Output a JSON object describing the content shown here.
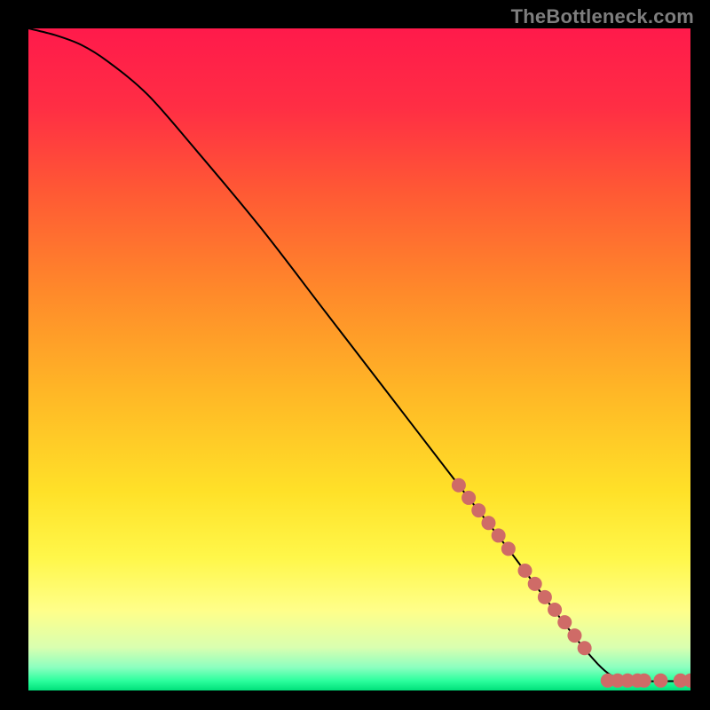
{
  "attribution": "TheBottleneck.com",
  "chart_data": {
    "type": "line",
    "title": "",
    "xlabel": "",
    "ylabel": "",
    "xlim": [
      0,
      100
    ],
    "ylim": [
      0,
      100
    ],
    "background_gradient": {
      "stops": [
        {
          "offset": 0.0,
          "color": "#ff1a4b"
        },
        {
          "offset": 0.12,
          "color": "#ff2e44"
        },
        {
          "offset": 0.25,
          "color": "#ff5a34"
        },
        {
          "offset": 0.4,
          "color": "#ff8a2a"
        },
        {
          "offset": 0.55,
          "color": "#ffb726"
        },
        {
          "offset": 0.7,
          "color": "#ffe128"
        },
        {
          "offset": 0.8,
          "color": "#fff74a"
        },
        {
          "offset": 0.88,
          "color": "#ffff8a"
        },
        {
          "offset": 0.935,
          "color": "#d9ffb0"
        },
        {
          "offset": 0.965,
          "color": "#8cffc0"
        },
        {
          "offset": 0.985,
          "color": "#2dff9e"
        },
        {
          "offset": 1.0,
          "color": "#00e07a"
        }
      ]
    },
    "series": [
      {
        "name": "curve",
        "color": "#000000",
        "points": [
          {
            "x": 0,
            "y": 100
          },
          {
            "x": 4,
            "y": 99
          },
          {
            "x": 8,
            "y": 97.5
          },
          {
            "x": 12,
            "y": 95
          },
          {
            "x": 18,
            "y": 90
          },
          {
            "x": 25,
            "y": 82
          },
          {
            "x": 35,
            "y": 70
          },
          {
            "x": 45,
            "y": 57
          },
          {
            "x": 55,
            "y": 44
          },
          {
            "x": 65,
            "y": 31
          },
          {
            "x": 72,
            "y": 22
          },
          {
            "x": 78,
            "y": 14
          },
          {
            "x": 83,
            "y": 7.5
          },
          {
            "x": 86,
            "y": 4
          },
          {
            "x": 88,
            "y": 2.3
          },
          {
            "x": 90,
            "y": 1.6
          },
          {
            "x": 93,
            "y": 1.4
          },
          {
            "x": 97,
            "y": 1.4
          },
          {
            "x": 100,
            "y": 1.4
          }
        ]
      }
    ],
    "highlight_points": {
      "name": "highlights",
      "color": "#cf6b67",
      "radius_px": 8,
      "points": [
        {
          "x": 65.0,
          "y": 31.0
        },
        {
          "x": 66.5,
          "y": 29.1
        },
        {
          "x": 68.0,
          "y": 27.2
        },
        {
          "x": 69.5,
          "y": 25.3
        },
        {
          "x": 71.0,
          "y": 23.4
        },
        {
          "x": 72.5,
          "y": 21.4
        },
        {
          "x": 75.0,
          "y": 18.1
        },
        {
          "x": 76.5,
          "y": 16.1
        },
        {
          "x": 78.0,
          "y": 14.1
        },
        {
          "x": 79.5,
          "y": 12.2
        },
        {
          "x": 81.0,
          "y": 10.3
        },
        {
          "x": 82.5,
          "y": 8.3
        },
        {
          "x": 84.0,
          "y": 6.4
        },
        {
          "x": 87.5,
          "y": 1.5
        },
        {
          "x": 89.0,
          "y": 1.5
        },
        {
          "x": 90.5,
          "y": 1.5
        },
        {
          "x": 92.0,
          "y": 1.5
        },
        {
          "x": 93.0,
          "y": 1.5
        },
        {
          "x": 95.5,
          "y": 1.5
        },
        {
          "x": 98.5,
          "y": 1.5
        },
        {
          "x": 100.0,
          "y": 1.5
        }
      ]
    }
  }
}
